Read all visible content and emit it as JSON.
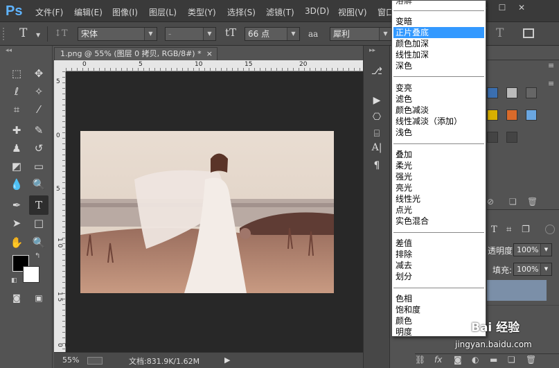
{
  "app": {
    "logo": "Ps"
  },
  "menu": [
    "文件(F)",
    "编辑(E)",
    "图像(I)",
    "图层(L)",
    "类型(Y)",
    "选择(S)",
    "滤镜(T)",
    "3D(D)",
    "视图(V)",
    "窗口"
  ],
  "window_controls": {
    "minimize": "—",
    "restore": "☐",
    "close": "✕"
  },
  "options_bar": {
    "type_tool_icon": "T",
    "orient_icon": "↕T",
    "font_family": "宋体",
    "font_style": "-",
    "size_icon": "tT",
    "font_size": "66 点",
    "aa_icon": "aa",
    "antialias": "犀利",
    "warp_icon": "T"
  },
  "document": {
    "tab_title": "1.png @ 55% (图层 0 拷贝, RGB/8#) *",
    "close": "×",
    "ruler_h_ticks": [
      "0",
      "5",
      "10",
      "15",
      "20"
    ],
    "ruler_v_ticks": [
      "5",
      "0",
      "5",
      "1 0",
      "1 5",
      "2 0"
    ]
  },
  "status": {
    "zoom": "55%",
    "doc_info": "文档:831.9K/1.62M",
    "arrow": "▶"
  },
  "blend_modes": {
    "partial_top": "溶解",
    "groups": [
      [
        "变暗",
        "正片叠底",
        "颜色加深",
        "线性加深",
        "深色"
      ],
      [
        "变亮",
        "滤色",
        "颜色减淡",
        "线性减淡（添加）",
        "浅色"
      ],
      [
        "叠加",
        "柔光",
        "强光",
        "亮光",
        "线性光",
        "点光",
        "实色混合"
      ],
      [
        "差值",
        "排除",
        "减去",
        "划分"
      ],
      [
        "色相",
        "饱和度",
        "颜色",
        "明度"
      ]
    ],
    "selected": "正片叠底"
  },
  "layers_panel": {
    "opacity_label": "透明度:",
    "opacity_value": "100%",
    "fill_label": "填充:",
    "fill_value": "100%"
  },
  "tools": [
    "marquee",
    "move",
    "lasso",
    "magic-wand",
    "crop",
    "eyedropper",
    "healing",
    "brush",
    "stamp",
    "history-brush",
    "eraser",
    "gradient",
    "blur",
    "dodge",
    "pen",
    "type",
    "path-select",
    "shape",
    "hand",
    "zoom"
  ],
  "watermark": {
    "brand": "Bai 经验",
    "url": "jingyan.baidu.com"
  },
  "colors": {
    "accent": "#3399ff",
    "panel": "#535353",
    "bg": "#282828"
  }
}
